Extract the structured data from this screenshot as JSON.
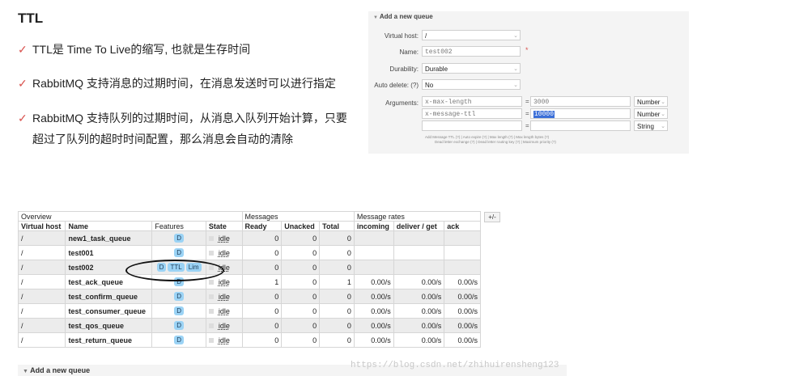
{
  "slide": {
    "title": "TTL",
    "bullets": [
      "TTL是 Time To Live的缩写, 也就是生存时间",
      "RabbitMQ 支持消息的过期时间，在消息发送时可以进行指定",
      "RabbitMQ 支持队列的过期时间，从消息入队列开始计算，只要",
      "超过了队列的超时时间配置，那么消息会自动的清除"
    ],
    "check_glyph": "✓"
  },
  "queue_form": {
    "heading": "Add a new queue",
    "virtual_host": {
      "label": "Virtual host:",
      "value": "/"
    },
    "name": {
      "label": "Name:",
      "value": "test002",
      "required": "*"
    },
    "durability": {
      "label": "Durability:",
      "value": "Durable"
    },
    "auto_delete": {
      "label": "Auto delete: (?)",
      "value": "No"
    },
    "arguments": {
      "label": "Arguments:",
      "rows": [
        {
          "key": "x-max-length",
          "eq": "=",
          "value": "3000",
          "type": "Number"
        },
        {
          "key": "x-message-ttl",
          "eq": "=",
          "value": "10000",
          "type": "Number"
        },
        {
          "key": "",
          "eq": "=",
          "value": "",
          "type": "String"
        }
      ],
      "help_line1": "Add   Message TTL (?) | Auto expire (?) | Max length (?) | Max length bytes (?)",
      "help_line2": "Dead letter exchange (?) | Dead letter routing key (?) | Maximum priority (?)"
    }
  },
  "overview": {
    "toggle": "+/-",
    "groups": {
      "overview": "Overview",
      "messages": "Messages",
      "rates": "Message rates"
    },
    "columns": [
      "Virtual host",
      "Name",
      "Features",
      "State",
      "Ready",
      "Unacked",
      "Total",
      "incoming",
      "deliver / get",
      "ack"
    ],
    "rows": [
      {
        "vhost": "/",
        "name": "new1_task_queue",
        "features": [
          "D"
        ],
        "state": "idle",
        "ready": "0",
        "unacked": "0",
        "total": "0",
        "incoming": "",
        "deliver": "",
        "ack": ""
      },
      {
        "vhost": "/",
        "name": "test001",
        "features": [
          "D"
        ],
        "state": "idle",
        "ready": "0",
        "unacked": "0",
        "total": "0",
        "incoming": "",
        "deliver": "",
        "ack": ""
      },
      {
        "vhost": "/",
        "name": "test002",
        "features": [
          "D",
          "TTL",
          "Lim"
        ],
        "state": "idle",
        "ready": "0",
        "unacked": "0",
        "total": "0",
        "incoming": "",
        "deliver": "",
        "ack": ""
      },
      {
        "vhost": "/",
        "name": "test_ack_queue",
        "features": [
          "D"
        ],
        "state": "idle",
        "ready": "1",
        "unacked": "0",
        "total": "1",
        "incoming": "0.00/s",
        "deliver": "0.00/s",
        "ack": "0.00/s"
      },
      {
        "vhost": "/",
        "name": "test_confirm_queue",
        "features": [
          "D"
        ],
        "state": "idle",
        "ready": "0",
        "unacked": "0",
        "total": "0",
        "incoming": "0.00/s",
        "deliver": "0.00/s",
        "ack": "0.00/s"
      },
      {
        "vhost": "/",
        "name": "test_consumer_queue",
        "features": [
          "D"
        ],
        "state": "idle",
        "ready": "0",
        "unacked": "0",
        "total": "0",
        "incoming": "0.00/s",
        "deliver": "0.00/s",
        "ack": "0.00/s"
      },
      {
        "vhost": "/",
        "name": "test_qos_queue",
        "features": [
          "D"
        ],
        "state": "idle",
        "ready": "0",
        "unacked": "0",
        "total": "0",
        "incoming": "0.00/s",
        "deliver": "0.00/s",
        "ack": "0.00/s"
      },
      {
        "vhost": "/",
        "name": "test_return_queue",
        "features": [
          "D"
        ],
        "state": "idle",
        "ready": "0",
        "unacked": "0",
        "total": "0",
        "incoming": "0.00/s",
        "deliver": "0.00/s",
        "ack": "0.00/s"
      }
    ]
  },
  "bottom": {
    "add_queue": "Add a new queue",
    "arrow": "▼"
  },
  "watermark": "https://blog.csdn.net/zhihuirensheng123",
  "colors": {
    "check": "#d9534f",
    "badge": "#9bd3f5",
    "highlight": "#3b6fd8"
  }
}
